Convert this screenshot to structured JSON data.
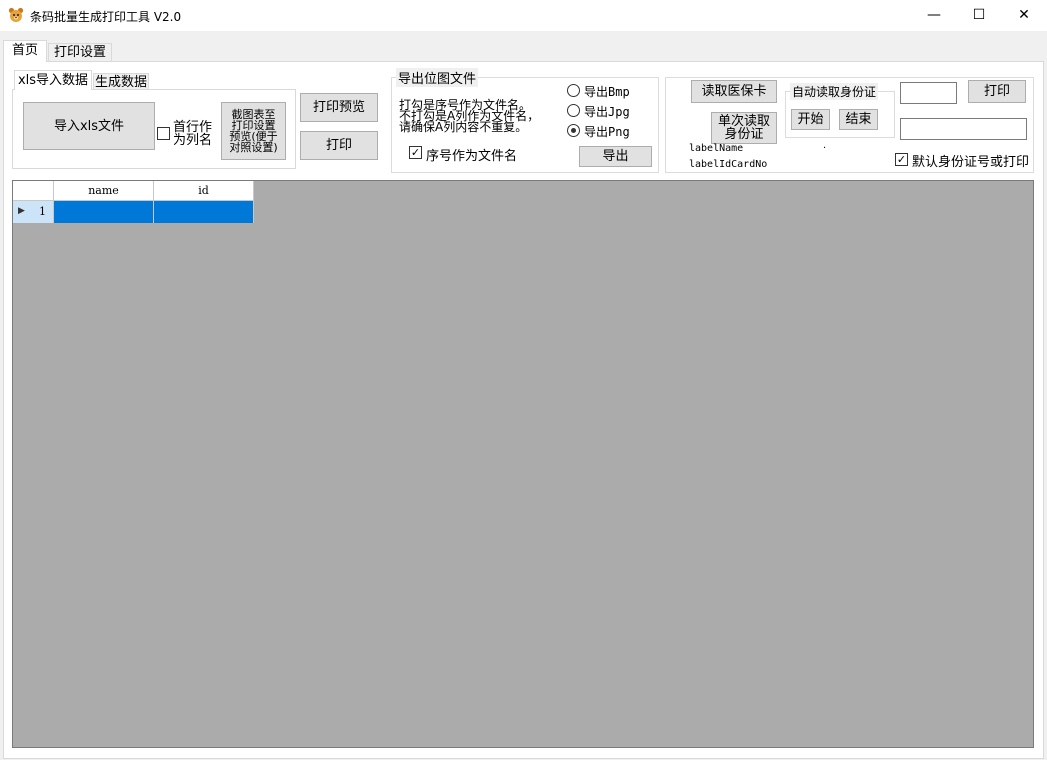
{
  "window": {
    "title": "条码批量生成打印工具 V2.0",
    "controls": {
      "minimize": "—",
      "maximize": "☐",
      "close": "✕"
    }
  },
  "main_tabs": [
    {
      "label": "首页",
      "active": true
    },
    {
      "label": "打印设置",
      "active": false
    }
  ],
  "data_tabs": [
    {
      "label": "xls导入数据",
      "active": true
    },
    {
      "label": "生成数据",
      "active": false
    }
  ],
  "import_panel": {
    "import_button": "导入xls文件",
    "first_row_checkbox_line1": "首行作",
    "first_row_checkbox_line2": "为列名",
    "first_row_checked": false,
    "screenshot_button_lines": [
      "截图表至",
      "打印设置",
      "预览(便于",
      "对照设置)"
    ]
  },
  "print_buttons": {
    "preview": "打印预览",
    "print": "打印"
  },
  "export_group": {
    "title": "导出位图文件",
    "hint_lines": [
      "打勾是序号作为文件名。",
      "不打勾是A列作为文件名，",
      "请确保A列内容不重复。"
    ],
    "serial_checkbox_label": "序号作为文件名",
    "serial_checked": true,
    "formats": [
      {
        "label": "导出Bmp",
        "selected": false
      },
      {
        "label": "导出Jpg",
        "selected": false
      },
      {
        "label": "导出Png",
        "selected": true
      }
    ],
    "export_button": "导出"
  },
  "card_panel": {
    "read_medical_card_button": "读取医保卡",
    "single_read_id_button_line1": "单次读取",
    "single_read_id_button_line2": "身份证",
    "label_name": "labelName",
    "label_id_card_no": "labelIdCardNo",
    "dot": "·",
    "auto_read_group_title": "自动读取身份证",
    "start_button": "开始",
    "stop_button": "结束",
    "input_top_value": "",
    "input_bottom_value": "",
    "print_button": "打印",
    "default_print_checkbox_label": "默认身份证号或打印",
    "default_print_checked": true
  },
  "grid": {
    "columns": [
      "name",
      "id"
    ],
    "rows": [
      {
        "index": "1",
        "name": "",
        "id": "",
        "selected": true
      }
    ],
    "row_indicator": "▶"
  },
  "colors": {
    "selection": "#0078d7",
    "grid_background": "#ababab",
    "window_background": "#f0f0f0"
  },
  "icons": {
    "app": "bear-icon",
    "checkmark": "✓"
  }
}
